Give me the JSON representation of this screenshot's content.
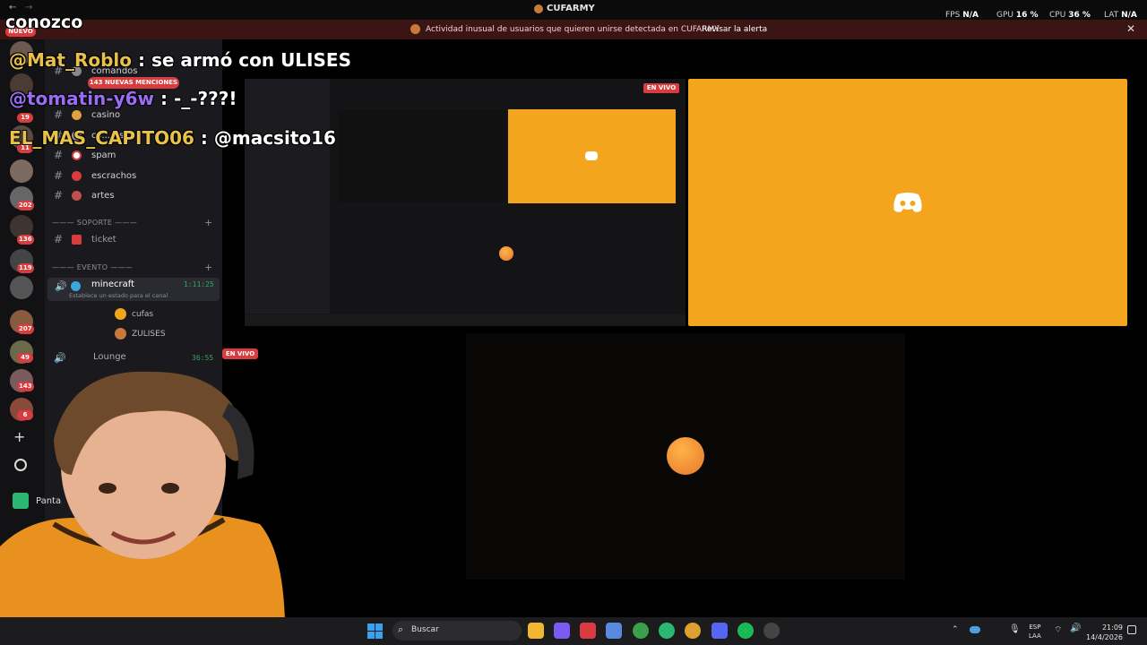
{
  "window": {
    "title": "CUFARMY"
  },
  "stats": {
    "fps_label": "FPS",
    "fps_value": "N/A",
    "gpu_label": "GPU",
    "gpu_value": "16 %",
    "cpu_label": "CPU",
    "cpu_value": "36 %",
    "lat_label": "LAT",
    "lat_value": "N/A"
  },
  "alert": {
    "text": "Actividad inusual de usuarios que quieren unirse detectada en CUFARMY",
    "link": "Revisar la alerta"
  },
  "rail": {
    "new_badge": "NUEVO",
    "badges": [
      "19",
      "11",
      "202",
      "136",
      "119",
      "207",
      "49",
      "143",
      "6"
    ]
  },
  "mentions": "143 NUEVAS MENCIONES",
  "channels": {
    "items": [
      {
        "name": "comandos"
      },
      {
        "name": "casino"
      },
      {
        "name": "co...ros"
      },
      {
        "name": "spam"
      },
      {
        "name": "escrachos"
      },
      {
        "name": "artes"
      }
    ],
    "cat_support": "SOPORTE",
    "ticket": "ticket",
    "cat_event": "EVENTO",
    "voice_channel": "minecraft",
    "voice_time": "1:11:25",
    "status_hint": "Establece un estado para el canal",
    "voice_users": [
      "cufas",
      "ZULISES"
    ],
    "live_label": "EN VIVO",
    "lounge": "Lounge",
    "lounge_time": "36:55",
    "pantalla": "Panta"
  },
  "overlay": {
    "brand": "conozco",
    "messages": [
      {
        "user": "@Mat_Roblo",
        "text": " : se armó con ULISES"
      },
      {
        "user": "@tomatin-y6w",
        "text": " : -_-???!"
      },
      {
        "user": "EL_MAS_CAPITO06",
        "text": " : @macsito16"
      }
    ]
  },
  "stage": {
    "live_label": "EN VIVO"
  },
  "taskbar": {
    "search_placeholder": "Buscar",
    "lang1": "ESP",
    "lang2": "LAA",
    "time": "21:09",
    "date": "14/4/2026"
  },
  "colors": {
    "discord_orange": "#f4a51e",
    "live_red": "#d83c3e",
    "alert_bg": "#3a1513"
  }
}
